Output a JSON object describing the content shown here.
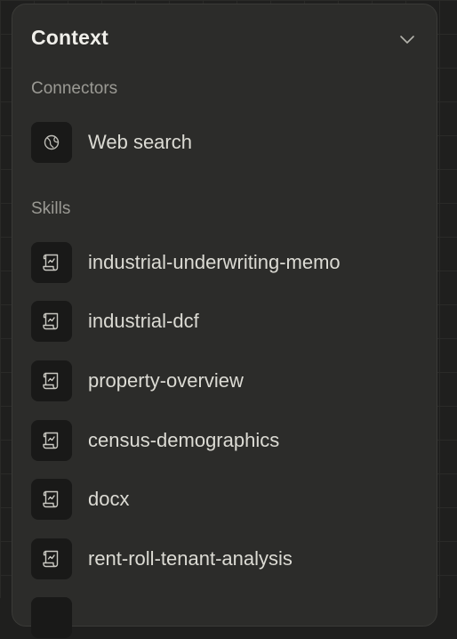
{
  "panel": {
    "title": "Context"
  },
  "connectors": {
    "label": "Connectors",
    "items": [
      {
        "label": "Web search",
        "icon": "globe-icon"
      }
    ]
  },
  "skills": {
    "label": "Skills",
    "items": [
      {
        "label": "industrial-underwriting-memo",
        "icon": "scroll-icon"
      },
      {
        "label": "industrial-dcf",
        "icon": "scroll-icon"
      },
      {
        "label": "property-overview",
        "icon": "scroll-icon"
      },
      {
        "label": "census-demographics",
        "icon": "scroll-icon"
      },
      {
        "label": "docx",
        "icon": "scroll-icon"
      },
      {
        "label": "rent-roll-tenant-analysis",
        "icon": "scroll-icon"
      }
    ]
  },
  "colors": {
    "background": "#1f1f1e",
    "panel": "#2c2c2a",
    "icon_tile": "#191918",
    "text_primary": "#f0efea",
    "text_secondary": "#9b9a94"
  }
}
